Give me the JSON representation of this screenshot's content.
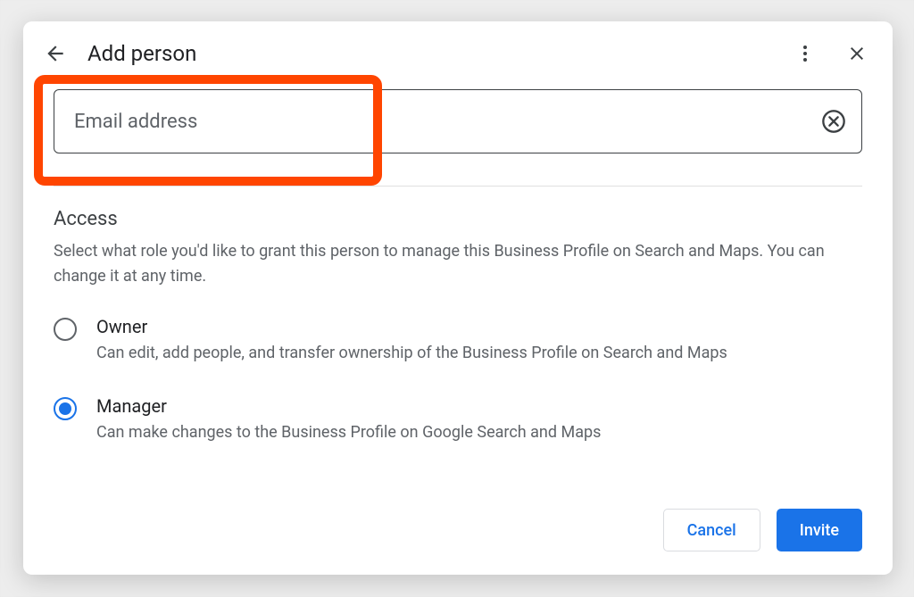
{
  "header": {
    "title": "Add person"
  },
  "email": {
    "placeholder": "Email address",
    "value": ""
  },
  "access": {
    "section_title": "Access",
    "section_desc": "Select what role you'd like to grant this person to manage this Business Profile on Search and Maps. You can change it at any time.",
    "selected": "manager",
    "options": [
      {
        "key": "owner",
        "label": "Owner",
        "desc": "Can edit, add people, and transfer ownership of the Business Profile on Search and Maps"
      },
      {
        "key": "manager",
        "label": "Manager",
        "desc": "Can make changes to the Business Profile on Google Search and Maps"
      }
    ]
  },
  "footer": {
    "cancel_label": "Cancel",
    "invite_label": "Invite"
  },
  "colors": {
    "highlight": "#ff4500",
    "primary": "#1a73e8"
  }
}
